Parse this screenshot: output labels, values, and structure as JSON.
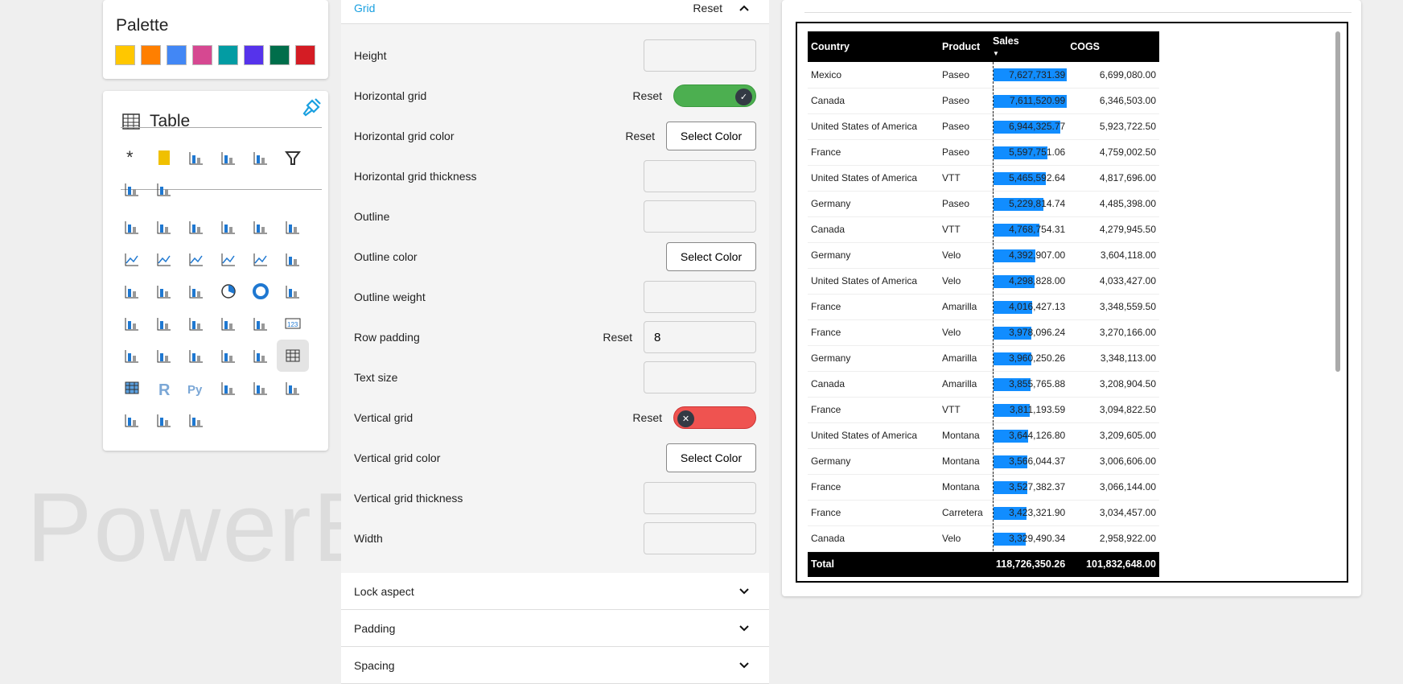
{
  "palette": {
    "title": "Palette",
    "colors": [
      "#ffc700",
      "#ff7f00",
      "#4287f5",
      "#d64891",
      "#039ca3",
      "#5633eb",
      "#006e4b",
      "#d41c24"
    ]
  },
  "visualizations": {
    "selected": "Table",
    "title": "Table",
    "tool_icons": [
      "asterisk-icon",
      "page-icon",
      "qr-icon",
      "shapes-icon",
      "button-icon",
      "filter-icon",
      "grid-icon",
      "bookmark-icon"
    ],
    "chart_icons": [
      "stacked-bar-icon",
      "stacked-column-icon",
      "clustered-bar-icon",
      "clustered-column-icon",
      "100-bar-icon",
      "100-column-icon",
      "line-chart-icon",
      "area-chart-icon",
      "stacked-area-icon",
      "line-column-icon",
      "line-clustered-column-icon",
      "ribbon-chart-icon",
      "waterfall-icon",
      "funnel-icon",
      "scatter-icon",
      "pie-icon",
      "donut-icon",
      "treemap-icon",
      "globe-map-icon",
      "filled-map-icon",
      "shape-map-icon",
      "azure-map-icon",
      "gauge-icon",
      "card-icon",
      "multi-card-icon",
      "kpi-icon",
      "kpi-arrows-icon",
      "slicer-icon",
      "smart-slicer-icon",
      "table-icon",
      "matrix-icon",
      "r-visual-icon",
      "python-visual-icon",
      "key-influencers-icon",
      "decomposition-tree-icon",
      "qa-icon",
      "text-box-icon",
      "trophy-icon",
      "paginated-report-icon"
    ]
  },
  "watermark": "PowerB",
  "format": {
    "section": "Grid",
    "reset": "Reset",
    "rows": [
      {
        "label": "Height",
        "type": "input",
        "value": ""
      },
      {
        "label": "Horizontal grid",
        "type": "toggle",
        "on": true,
        "reset": "Reset"
      },
      {
        "label": "Horizontal grid color",
        "type": "color",
        "reset": "Reset",
        "button": "Select Color"
      },
      {
        "label": "Horizontal grid thickness",
        "type": "input",
        "value": ""
      },
      {
        "label": "Outline",
        "type": "input",
        "value": ""
      },
      {
        "label": "Outline color",
        "type": "color",
        "button": "Select Color"
      },
      {
        "label": "Outline weight",
        "type": "input",
        "value": ""
      },
      {
        "label": "Row padding",
        "type": "input",
        "value": "8",
        "reset": "Reset"
      },
      {
        "label": "Text size",
        "type": "input",
        "value": ""
      },
      {
        "label": "Vertical grid",
        "type": "toggle",
        "on": false,
        "reset": "Reset"
      },
      {
        "label": "Vertical grid color",
        "type": "color",
        "button": "Select Color"
      },
      {
        "label": "Vertical grid thickness",
        "type": "input",
        "value": ""
      },
      {
        "label": "Width",
        "type": "input",
        "value": ""
      }
    ],
    "collapsed": [
      "Lock aspect",
      "Padding",
      "Spacing"
    ],
    "toggle_on_color": "#4caf50",
    "toggle_off_color": "#ef5350"
  },
  "table": {
    "columns": [
      "Country",
      "Product",
      "Sales",
      "COGS"
    ],
    "sort": "Sales descending",
    "bar_color": "#118dff",
    "rows": [
      [
        "Mexico",
        "Paseo",
        "7,627,731.39",
        "6,699,080.00"
      ],
      [
        "Canada",
        "Paseo",
        "7,611,520.99",
        "6,346,503.00"
      ],
      [
        "United States of America",
        "Paseo",
        "6,944,325.77",
        "5,923,722.50"
      ],
      [
        "France",
        "Paseo",
        "5,597,751.06",
        "4,759,002.50"
      ],
      [
        "United States of America",
        "VTT",
        "5,465,592.64",
        "4,817,696.00"
      ],
      [
        "Germany",
        "Paseo",
        "5,229,814.74",
        "4,485,398.00"
      ],
      [
        "Canada",
        "VTT",
        "4,768,754.31",
        "4,279,945.50"
      ],
      [
        "Germany",
        "Velo",
        "4,392,907.00",
        "3,604,118.00"
      ],
      [
        "United States of America",
        "Velo",
        "4,298,828.00",
        "4,033,427.00"
      ],
      [
        "France",
        "Amarilla",
        "4,016,427.13",
        "3,348,559.50"
      ],
      [
        "France",
        "Velo",
        "3,978,096.24",
        "3,270,166.00"
      ],
      [
        "Germany",
        "Amarilla",
        "3,960,250.26",
        "3,348,113.00"
      ],
      [
        "Canada",
        "Amarilla",
        "3,855,765.88",
        "3,208,904.50"
      ],
      [
        "France",
        "VTT",
        "3,811,193.59",
        "3,094,822.50"
      ],
      [
        "United States of America",
        "Montana",
        "3,644,126.80",
        "3,209,605.00"
      ],
      [
        "Germany",
        "Montana",
        "3,566,044.37",
        "3,006,606.00"
      ],
      [
        "France",
        "Montana",
        "3,527,382.37",
        "3,066,144.00"
      ],
      [
        "France",
        "Carretera",
        "3,423,321.90",
        "3,034,457.00"
      ],
      [
        "Canada",
        "Velo",
        "3,329,490.34",
        "2,958,922.00"
      ]
    ],
    "total": {
      "label": "Total",
      "sales": "118,726,350.26",
      "cogs": "101,832,648.00"
    }
  }
}
